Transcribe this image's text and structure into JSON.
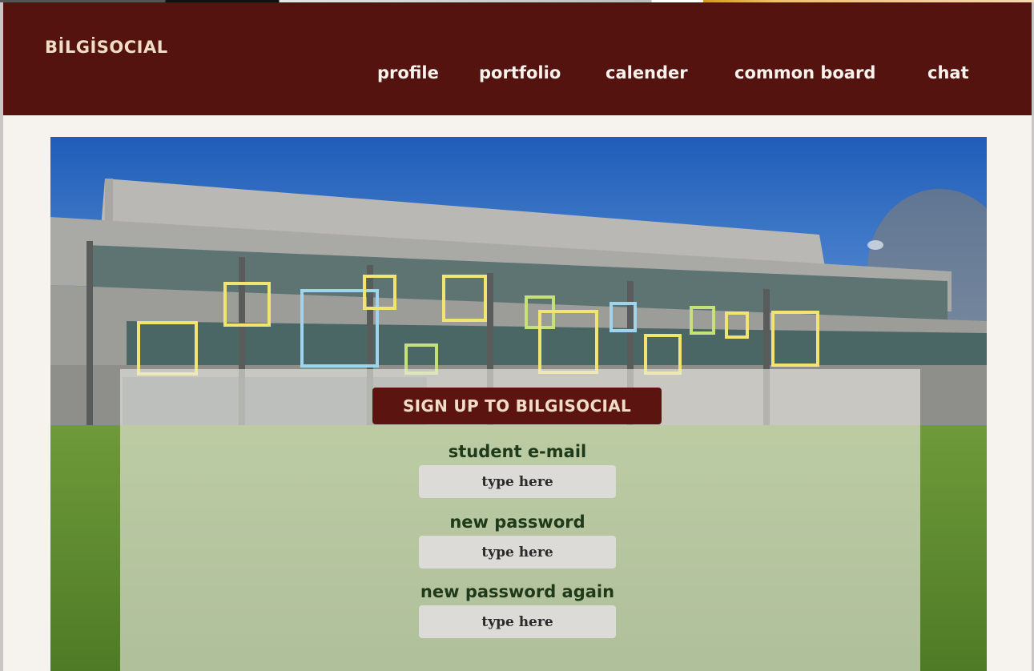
{
  "header": {
    "brand": "BİLGİSOCIAL",
    "nav": [
      {
        "label": "profile"
      },
      {
        "label": "portfolio"
      },
      {
        "label": "calender"
      },
      {
        "label": "common board"
      },
      {
        "label": "chat"
      }
    ]
  },
  "signup": {
    "title": "SIGN UP TO BILGISOCIAL",
    "fields": [
      {
        "label": "student e-mail",
        "placeholder": "type here"
      },
      {
        "label": "new password",
        "placeholder": "type here"
      },
      {
        "label": "new password again",
        "placeholder": "type here"
      }
    ]
  },
  "colors": {
    "header_bg": "#55130f",
    "brand_text": "#f0ddc6",
    "page_bg": "#f6f3ef",
    "label_text": "#1e3a1a",
    "window_outline_yellow": "#f2e470",
    "window_outline_blue": "#9fd3ee",
    "window_outline_green": "#c6e07a"
  }
}
